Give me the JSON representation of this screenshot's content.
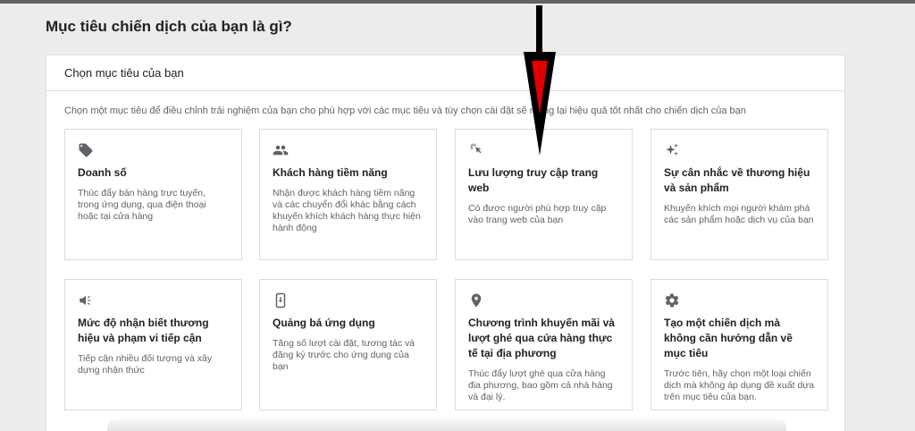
{
  "page": {
    "title": "Mục tiêu chiến dịch của bạn là gì?"
  },
  "panel": {
    "header": "Chọn mục tiêu của bạn",
    "description": "Chọn một mục tiêu để điều chỉnh trải nghiệm của bạn cho phù hợp với các mục tiêu và tùy chọn cài đặt sẽ mang lại hiệu quả tốt nhất cho chiến dịch của bạn"
  },
  "cards": [
    {
      "icon": "tag-icon",
      "title": "Doanh số",
      "desc": "Thúc đẩy bán hàng trực tuyến, trong ứng dụng, qua điện thoại hoặc tại cửa hàng"
    },
    {
      "icon": "people-icon",
      "title": "Khách hàng tiềm năng",
      "desc": "Nhận được khách hàng tiềm năng và các chuyển đổi khác bằng cách khuyến khích khách hàng thực hiện hành động"
    },
    {
      "icon": "cursor-click-icon",
      "title": "Lưu lượng truy cập trang web",
      "desc": "Có được người phù hợp truy cập vào trang web của bạn"
    },
    {
      "icon": "sparkle-icon",
      "title": "Sự cân nhắc về thương hiệu và sản phẩm",
      "desc": "Khuyến khích mọi người khám phá các sản phẩm hoặc dịch vụ của bạn"
    },
    {
      "icon": "megaphone-icon",
      "title": "Mức độ nhận biết thương hiệu và phạm vi tiếp cận",
      "desc": "Tiếp cận nhiều đối tượng và xây dựng nhận thức"
    },
    {
      "icon": "phone-download-icon",
      "title": "Quảng bá ứng dụng",
      "desc": "Tăng số lượt cài đặt, tương tác và đăng ký trước cho ứng dụng của bạn"
    },
    {
      "icon": "location-pin-icon",
      "title": "Chương trình khuyến mãi và lượt ghé qua cửa hàng thực tế tại địa phương",
      "desc": "Thúc đẩy lượt ghé qua cửa hàng địa phương, bao gồm cả nhà hàng và đại lý."
    },
    {
      "icon": "gear-icon",
      "title": "Tạo một chiến dịch mà không cần hướng dẫn về mục tiêu",
      "desc": "Trước tiên, hãy chọn một loại chiến dịch mà không áp dụng đề xuất dựa trên mục tiêu của bạn."
    }
  ],
  "colors": {
    "icon": "#5f6368",
    "arrow": "#000000",
    "arrow_accent": "#e00000"
  }
}
